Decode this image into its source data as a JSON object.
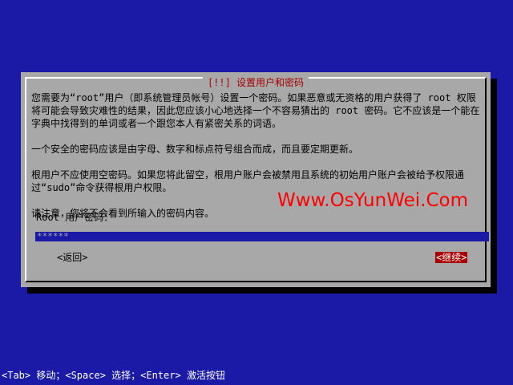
{
  "dialog": {
    "title": "[!!] 设置用户和密码",
    "paragraphs": [
      "您需要为“root”用户（即系统管理员帐号）设置一个密码。如果恶意或无资格的用户获得了 root 权限将可能会导致灾难性的结果，因此您应该小心地选择一个不容易猜出的 root 密码。它不应该是一个能在字典中找得到的单词或者一个跟您本人有紧密关系的词语。",
      "一个安全的密码应该是由字母、数字和标点符号组合而成，而且要定期更新。",
      "根用户不应使用空密码。如果您将此留空，根用户账户会被禁用且系统的初始用户账户会被给予权限通过“sudo”命令获得根用户权限。",
      "请注意，您将不会看到所输入的密码内容。"
    ],
    "prompt_label": "Root 用户密码：",
    "password_value": "******",
    "back_label": "<返回>",
    "continue_label": "<继续>"
  },
  "watermark": "Www.OsYunWei.Com",
  "status_bar": "<Tab> 移动；<Space> 选择；<Enter> 激活按钮",
  "colors": {
    "background": "#1a1aa6",
    "dialog": "#a8a8a8",
    "title": "#a80000",
    "selected_button": "#a80000",
    "watermark": "#ff0000"
  }
}
